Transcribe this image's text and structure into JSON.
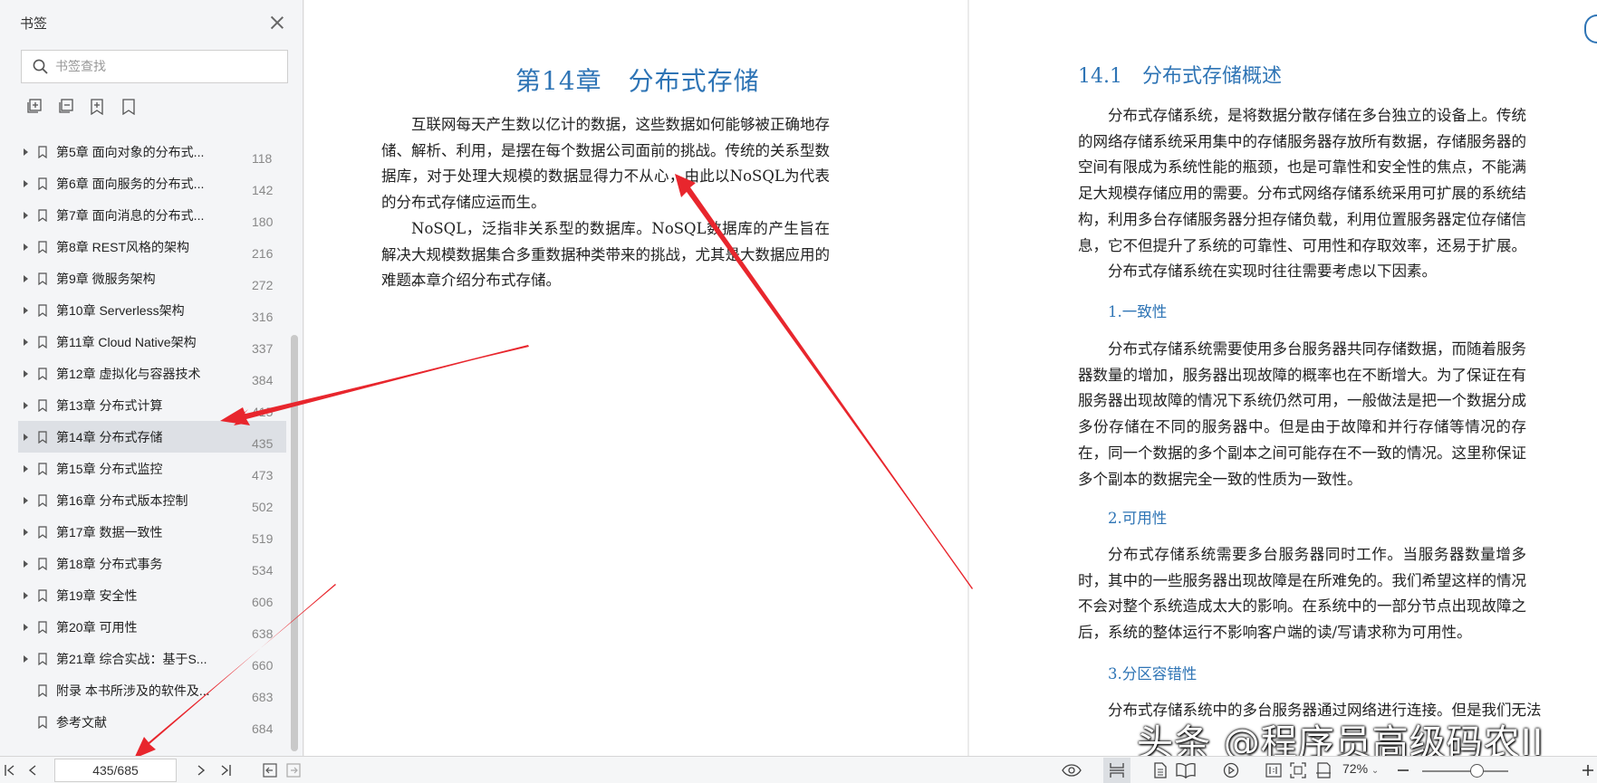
{
  "sidebar": {
    "title": "书签",
    "search_placeholder": "书签查找",
    "bookmarks": [
      {
        "label": "第5章 面向对象的分布式...",
        "page": "118",
        "arrow": true
      },
      {
        "label": "第6章 面向服务的分布式...",
        "page": "142",
        "arrow": true
      },
      {
        "label": "第7章 面向消息的分布式...",
        "page": "180",
        "arrow": true
      },
      {
        "label": "第8章 REST风格的架构",
        "page": "216",
        "arrow": true
      },
      {
        "label": "第9章 微服务架构",
        "page": "272",
        "arrow": true
      },
      {
        "label": "第10章 Serverless架构",
        "page": "316",
        "arrow": true
      },
      {
        "label": "第11章 Cloud Native架构",
        "page": "337",
        "arrow": true
      },
      {
        "label": "第12章 虚拟化与容器技术",
        "page": "384",
        "arrow": true
      },
      {
        "label": "第13章 分布式计算",
        "page": "415",
        "arrow": true
      },
      {
        "label": "第14章 分布式存储",
        "page": "435",
        "arrow": true,
        "active": true
      },
      {
        "label": "第15章 分布式监控",
        "page": "473",
        "arrow": true
      },
      {
        "label": "第16章 分布式版本控制",
        "page": "502",
        "arrow": true
      },
      {
        "label": "第17章 数据一致性",
        "page": "519",
        "arrow": true
      },
      {
        "label": "第18章 分布式事务",
        "page": "534",
        "arrow": true
      },
      {
        "label": "第19章 安全性",
        "page": "606",
        "arrow": true
      },
      {
        "label": "第20章 可用性",
        "page": "638",
        "arrow": true
      },
      {
        "label": "第21章 综合实战：基于S...",
        "page": "660",
        "arrow": true
      },
      {
        "label": "附录 本书所涉及的软件及...",
        "page": "683",
        "arrow": false
      },
      {
        "label": "参考文献",
        "page": "684",
        "arrow": false
      }
    ]
  },
  "left_page": {
    "chapter_title": "第14章　分布式存储",
    "paragraphs": [
      "互联网每天产生数以亿计的数据，这些数据如何能够被正确地存储、解析、利用，是摆在每个数据公司面前的挑战。传统的关系型数据库，对于处理大规模的数据显得力不从心，由此以NoSQL为代表的分布式存储应运而生。",
      "NoSQL，泛指非关系型的数据库。NoSQL数据库的产生旨在解决大规模数据集合多重数据种类带来的挑战，尤其是大数据应用的难题。",
      "本章介绍分布式存储。"
    ]
  },
  "right_page": {
    "section_title": "14.1　分布式存储概述",
    "p1": "分布式存储系统，是将数据分散存储在多台独立的设备上。传统的网络存储系统采用集中的存储服务器存放所有数据，存储服务器的空间有限成为系统性能的瓶颈，也是可靠性和安全性的焦点，不能满足大规模存储应用的需要。分布式网络存储系统采用可扩展的系统结构，利用多台存储服务器分担存储负载，利用位置服务器定位存储信息，它不但提升了系统的可靠性、可用性和存取效率，还易于扩展。",
    "p2": "分布式存储系统在实现时往往需要考虑以下因素。",
    "h1": "1.一致性",
    "p3": "分布式存储系统需要使用多台服务器共同存储数据，而随着服务器数量的增加，服务器出现故障的概率也在不断增大。为了保证在有服务器出现故障的情况下系统仍然可用，一般做法是把一个数据分成多份存储在不同的服务器中。但是由于故障和并行存储等情况的存在，同一个数据的多个副本之间可能存在不一致的情况。这里称保证多个副本的数据完全一致的性质为一致性。",
    "h2": "2.可用性",
    "p4": "分布式存储系统需要多台服务器同时工作。当服务器数量增多时，其中的一些服务器出现故障是在所难免的。我们希望这样的情况不会对整个系统造成太大的影响。在系统中的一部分节点出现故障之后，系统的整体运行不影响客户端的读/写请求称为可用性。",
    "h3": "3.分区容错性",
    "p5": "分布式存储系统中的多台服务器通过网络进行连接。但是我们无法"
  },
  "watermark": "头条 @程序员高级码农II",
  "bottombar": {
    "page_indicator": "435/685",
    "zoom": "72%"
  },
  "colors": {
    "heading_blue": "#2e74b5",
    "arrow_red": "#e8262d",
    "active_row": "#dde0e5"
  }
}
